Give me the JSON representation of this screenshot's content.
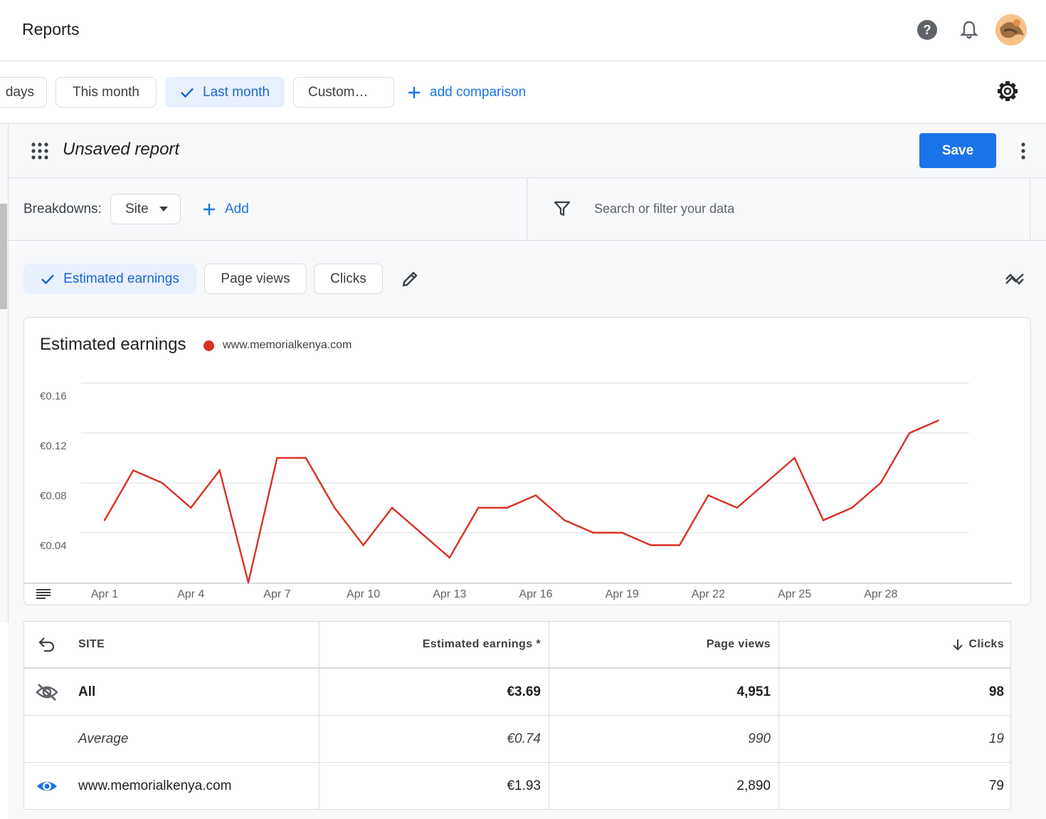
{
  "app": {
    "title": "Reports"
  },
  "header_icons": {
    "help": "help-icon",
    "notifications": "bell-icon",
    "avatar": "user-avatar"
  },
  "date_ranges": {
    "items": [
      {
        "label": "days",
        "selected": false
      },
      {
        "label": "This month",
        "selected": false
      },
      {
        "label": "Last month",
        "selected": true
      },
      {
        "label": "Custom…",
        "selected": false
      }
    ],
    "add_comparison": "add comparison"
  },
  "report": {
    "title": "Unsaved report",
    "save_label": "Save"
  },
  "breakdowns": {
    "label": "Breakdowns:",
    "selected": "Site",
    "add_label": "Add",
    "search_placeholder": "Search or filter your data"
  },
  "metrics": [
    {
      "label": "Estimated earnings",
      "selected": true
    },
    {
      "label": "Page views",
      "selected": false
    },
    {
      "label": "Clicks",
      "selected": false
    }
  ],
  "colors": {
    "accent": "#1a73e8",
    "selected_chip_bg": "#e8f0fe",
    "series": "#d93025"
  },
  "chart_data": {
    "type": "line",
    "title": "Estimated earnings",
    "series": [
      {
        "name": "www.memorialkenya.com",
        "color": "#d93025",
        "values": [
          0.05,
          0.09,
          0.08,
          0.06,
          0.09,
          0.0,
          0.1,
          0.1,
          0.06,
          0.03,
          0.06,
          0.04,
          0.02,
          0.06,
          0.06,
          0.07,
          0.05,
          0.04,
          0.04,
          0.03,
          0.03,
          0.07,
          0.06,
          0.08,
          0.1,
          0.05,
          0.06,
          0.08,
          0.12,
          0.13
        ]
      }
    ],
    "x": [
      "Apr 1",
      "Apr 2",
      "Apr 3",
      "Apr 4",
      "Apr 5",
      "Apr 6",
      "Apr 7",
      "Apr 8",
      "Apr 9",
      "Apr 10",
      "Apr 11",
      "Apr 12",
      "Apr 13",
      "Apr 14",
      "Apr 15",
      "Apr 16",
      "Apr 17",
      "Apr 18",
      "Apr 19",
      "Apr 20",
      "Apr 21",
      "Apr 22",
      "Apr 23",
      "Apr 24",
      "Apr 25",
      "Apr 26",
      "Apr 27",
      "Apr 28",
      "Apr 29",
      "Apr 30"
    ],
    "x_tick_labels": [
      "Apr 1",
      "Apr 4",
      "Apr 7",
      "Apr 10",
      "Apr 13",
      "Apr 16",
      "Apr 19",
      "Apr 22",
      "Apr 25",
      "Apr 28"
    ],
    "y_tick_labels": [
      "€0.16",
      "€0.12",
      "€0.08",
      "€0.04"
    ],
    "y_ticks": [
      0.16,
      0.12,
      0.08,
      0.04
    ],
    "ylim": [
      0,
      0.16
    ],
    "grid": true,
    "legend": "top-left"
  },
  "table": {
    "columns": {
      "site": "SITE",
      "earnings": "Estimated earnings *",
      "views": "Page views",
      "clicks": "Clicks"
    },
    "rows": [
      {
        "site": "All",
        "earnings": "€3.69",
        "views": "4,951",
        "clicks": "98",
        "style": "bold",
        "icon": "visibility-off-icon"
      },
      {
        "site": "Average",
        "earnings": "€0.74",
        "views": "990",
        "clicks": "19",
        "style": "italic",
        "icon": ""
      },
      {
        "site": "www.memorialkenya.com",
        "earnings": "€1.93",
        "views": "2,890",
        "clicks": "79",
        "style": "normal",
        "icon": "visibility-icon"
      }
    ]
  }
}
